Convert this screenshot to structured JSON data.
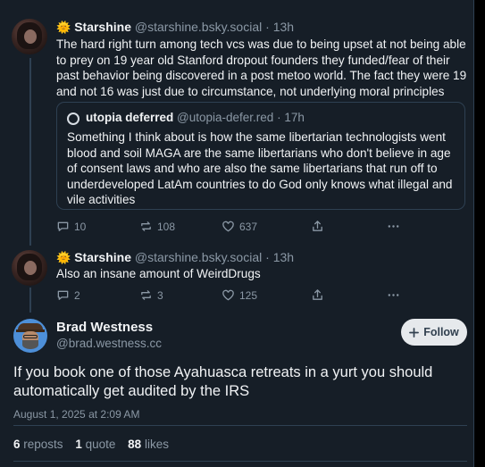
{
  "thread": [
    {
      "author_emoji": "🌞",
      "author_name": "Starshine",
      "author_handle": "@starshine.bsky.social",
      "sep": "·",
      "time": "13h",
      "text": "The hard right turn among tech vcs was due to being upset at not being able to prey on 19 year old Stanford dropout founders they funded/fear of their past behavior being discovered in a post metoo world. The fact they were 19 and not 16 was just due to circumstance, not underlying moral principles",
      "quote": {
        "author_name": "utopia deferred",
        "author_handle": "@utopia-defer.red",
        "sep": "·",
        "time": "17h",
        "text": "Something I think about is how the same libertarian technologists went blood and soil MAGA are the same libertarians who don't believe in age of consent laws and who are also the same libertarians that run off to underdeveloped LatAm countries to do God only knows what illegal and vile activities"
      },
      "replies": "10",
      "reposts": "108",
      "likes": "637"
    },
    {
      "author_emoji": "🌞",
      "author_name": "Starshine",
      "author_handle": "@starshine.bsky.social",
      "sep": "·",
      "time": "13h",
      "text": "Also an insane amount of WeirdDrugs",
      "replies": "2",
      "reposts": "3",
      "likes": "125"
    }
  ],
  "main": {
    "author_name": "Brad Westness",
    "author_handle": "@brad.westness.cc",
    "follow_label": "Follow",
    "text": "If you book one of those Ayahuasca retreats in a yurt you should automatically get audited by the IRS",
    "timestamp": "August 1, 2025 at 2:09 AM",
    "reposts_count": "6",
    "reposts_label": "reposts",
    "quotes_count": "1",
    "quotes_label": "quote",
    "likes_count": "88",
    "likes_label": "likes"
  }
}
